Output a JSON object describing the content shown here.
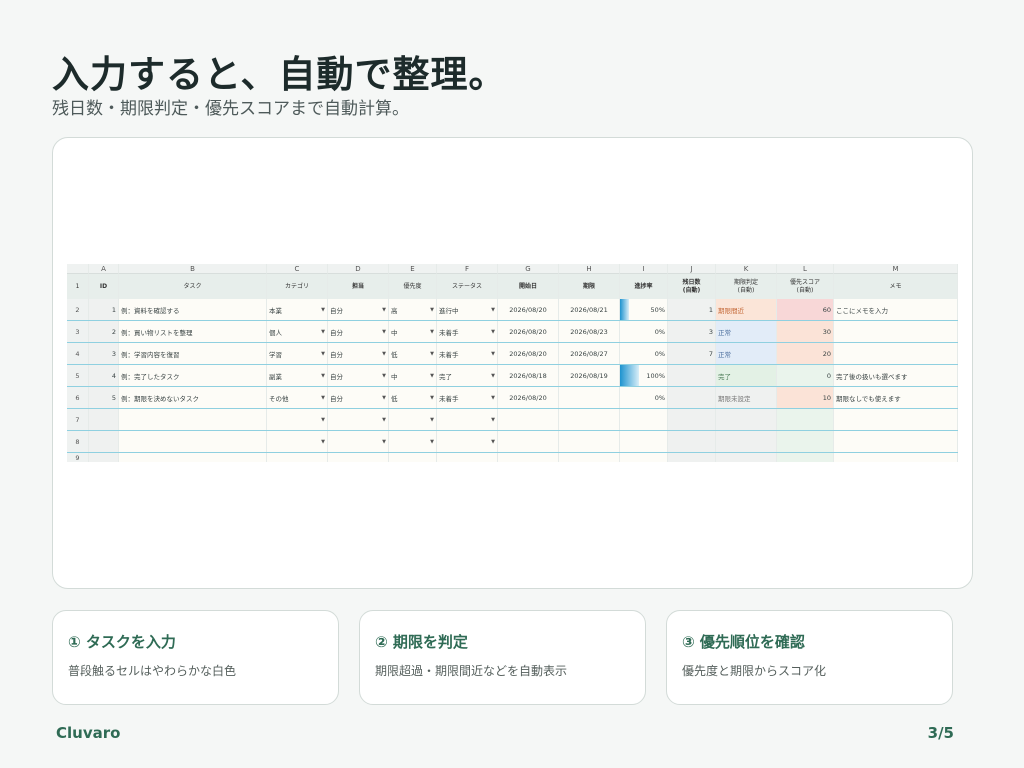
{
  "page": {
    "title": "入力すると、自動で整理。",
    "subtitle": "残日数・期限判定・優先スコアまで自動計算。",
    "brand": "Cluvaro",
    "pager": "3/5"
  },
  "sheet": {
    "columns": [
      "A",
      "B",
      "C",
      "D",
      "E",
      "F",
      "G",
      "H",
      "I",
      "J",
      "K",
      "L",
      "M"
    ],
    "row_numbers": [
      "1",
      "2",
      "3",
      "4",
      "5",
      "6",
      "7",
      "8",
      "9"
    ],
    "headers": [
      "ID",
      "タスク",
      "カテゴリ",
      "担当",
      "優先度",
      "ステータス",
      "開始日",
      "期限",
      "進捗率",
      "残日数\n(自動)",
      "期限判定\n(自動)",
      "優先スコア\n(自動)",
      "メモ"
    ],
    "rows": [
      {
        "id": "1",
        "task": "例：資料を確認する",
        "category": "本業",
        "owner": "自分",
        "priority": "高",
        "status": "進行中",
        "start": "2026/08/20",
        "due": "2026/08/21",
        "progress": "50%",
        "progress_value": 0.5,
        "days": "1",
        "judge": "期限間近",
        "judge_tone": "orange",
        "score": "60",
        "score_tone": "red",
        "memo": "ここにメモを入力"
      },
      {
        "id": "2",
        "task": "例：買い物リストを整理",
        "category": "個人",
        "owner": "自分",
        "priority": "中",
        "status": "未着手",
        "start": "2026/08/20",
        "due": "2026/08/23",
        "progress": "0%",
        "progress_value": 0,
        "days": "3",
        "judge": "正常",
        "judge_tone": "blue",
        "score": "30",
        "score_tone": "peach",
        "memo": ""
      },
      {
        "id": "3",
        "task": "例：学習内容を復習",
        "category": "学習",
        "owner": "自分",
        "priority": "低",
        "status": "未着手",
        "start": "2026/08/20",
        "due": "2026/08/27",
        "progress": "0%",
        "progress_value": 0,
        "days": "7",
        "judge": "正常",
        "judge_tone": "blue",
        "score": "20",
        "score_tone": "peach",
        "memo": ""
      },
      {
        "id": "4",
        "task": "例：完了したタスク",
        "category": "副業",
        "owner": "自分",
        "priority": "中",
        "status": "完了",
        "start": "2026/08/18",
        "due": "2026/08/19",
        "progress": "100%",
        "progress_value": 1,
        "days": "",
        "judge": "完了",
        "judge_tone": "green",
        "score": "0",
        "score_tone": "mint",
        "memo": "完了後の扱いも選べます"
      },
      {
        "id": "5",
        "task": "例：期限を決めないタスク",
        "category": "その他",
        "owner": "自分",
        "priority": "低",
        "status": "未着手",
        "start": "2026/08/20",
        "due": "",
        "progress": "0%",
        "progress_value": 0,
        "days": "",
        "judge": "期限未設定",
        "judge_tone": "gray",
        "score": "10",
        "score_tone": "peach",
        "memo": "期限なしでも使えます"
      }
    ]
  },
  "cards": [
    {
      "title": "① タスクを入力",
      "desc": "普段触るセルはやわらかな白色"
    },
    {
      "title": "② 期限を判定",
      "desc": "期限超過・期限間近などを自動表示"
    },
    {
      "title": "③ 優先順位を確認",
      "desc": "優先度と期限からスコア化"
    }
  ],
  "icons": {
    "dropdown": "dropdown-arrow-icon",
    "dropdown_glyph": "▼"
  }
}
